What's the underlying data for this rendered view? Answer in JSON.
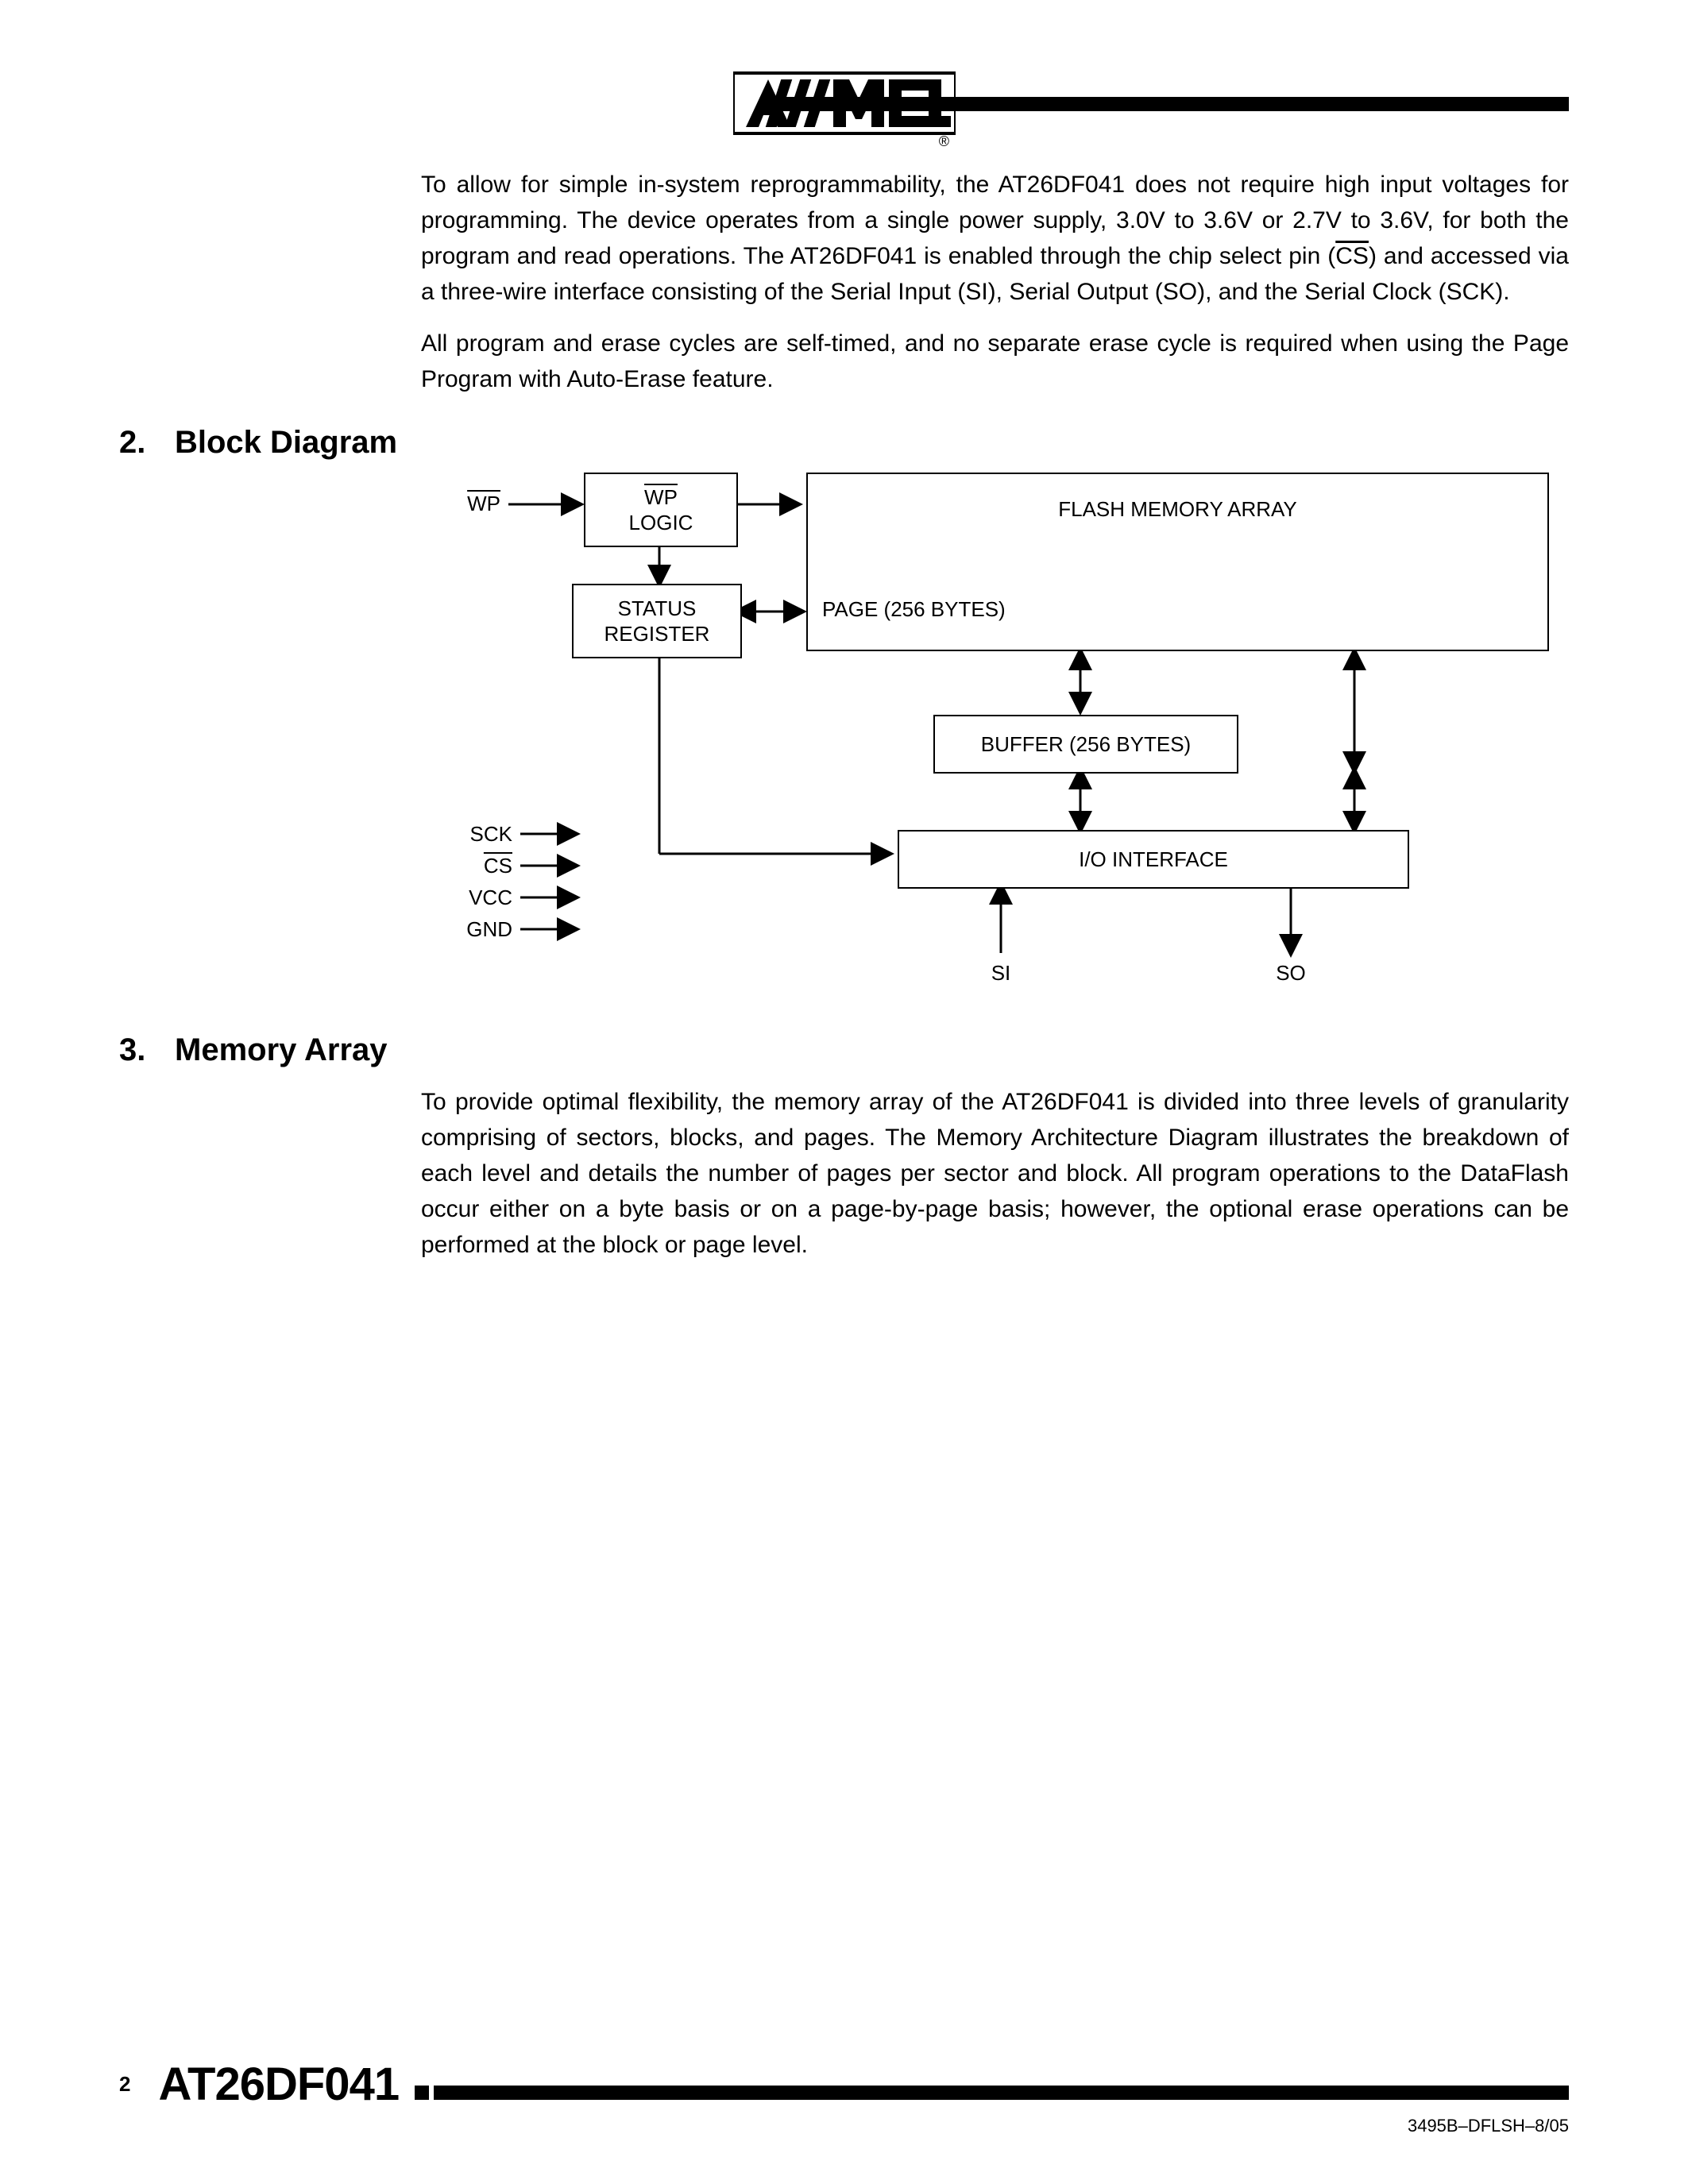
{
  "header": {
    "logo_text": "ATMEL",
    "registered_mark": "®"
  },
  "intro": {
    "p1": "To allow for simple in-system reprogrammability, the AT26DF041 does not require high input voltages for programming. The device operates from a single power supply, 3.0V to 3.6V or 2.7V to 3.6V, for both the program and read operations. The AT26DF041 is enabled through the chip select pin (CS) and accessed via a three-wire interface consisting of the Serial Input (SI), Serial Output (SO), and the Serial Clock (SCK).",
    "p2": "All program and erase cycles are self-timed, and no separate erase cycle is required when using the Page Program with Auto-Erase feature."
  },
  "sections": {
    "s2": {
      "num": "2.",
      "title": "Block Diagram"
    },
    "s3": {
      "num": "3.",
      "title": "Memory Array"
    }
  },
  "diagram": {
    "wp_pin": "WP",
    "wp_logic_top": "WP",
    "wp_logic_bot": "LOGIC",
    "status_top": "STATUS",
    "status_bot": "REGISTER",
    "flash": "FLASH MEMORY ARRAY",
    "page": "PAGE (256 BYTES)",
    "buffer": "BUFFER (256 BYTES)",
    "io": "I/O INTERFACE",
    "sck": "SCK",
    "cs": "CS",
    "vcc": "VCC",
    "gnd": "GND",
    "si": "SI",
    "so": "SO"
  },
  "memory_array_p": "To provide optimal flexibility, the memory array of the AT26DF041 is divided into three levels of granularity comprising of sectors, blocks, and pages. The Memory Architecture Diagram illustrates the breakdown of each level and details the number of pages per sector and block. All program operations to the DataFlash occur either on a byte basis or on a page-by-page basis; however, the optional erase operations can be performed at the block or page level.",
  "footer": {
    "page_number": "2",
    "title": "AT26DF041",
    "docid": "3495B–DFLSH–8/05"
  }
}
